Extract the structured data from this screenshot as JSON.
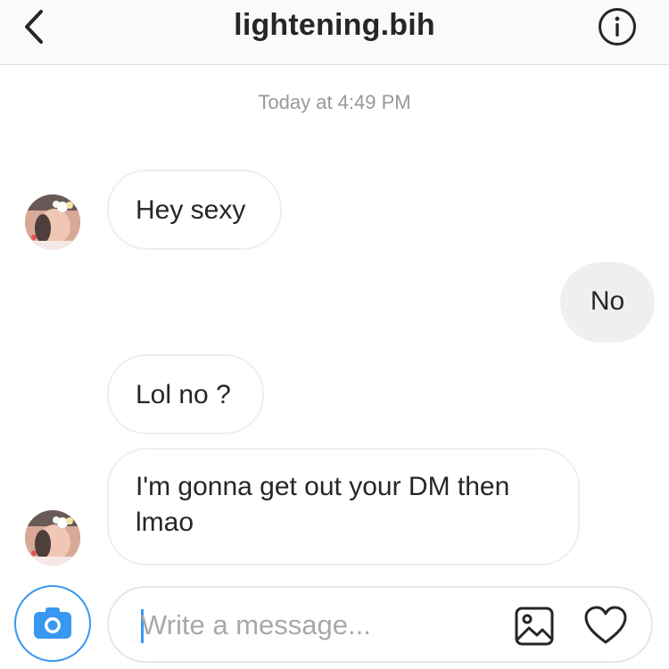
{
  "header": {
    "title": "lightening.bih",
    "back_icon": "chevron-left-icon",
    "info_icon": "info-icon"
  },
  "thread": {
    "timestamp": "Today at 4:49 PM",
    "messages": [
      {
        "sender": "other",
        "text": "Hey sexy"
      },
      {
        "sender": "me",
        "text": "No"
      },
      {
        "sender": "other",
        "text": "Lol no ?"
      },
      {
        "sender": "other",
        "text": "I'm gonna get out your DM then lmao"
      }
    ]
  },
  "composer": {
    "placeholder": "Write a message...",
    "value": "",
    "camera_icon": "camera-icon",
    "gallery_icon": "image-icon",
    "like_icon": "heart-icon"
  },
  "colors": {
    "accent": "#3897f0",
    "incoming_border": "#efefef",
    "outgoing_bg": "#efefef",
    "header_bg": "#fafafa",
    "timestamp": "#999999"
  }
}
